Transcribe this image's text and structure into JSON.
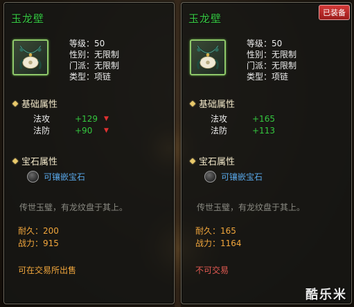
{
  "left_item": {
    "title": "玉龙壁",
    "level": "等级：50",
    "gender": "性别：无限制",
    "sect": "门派：无限制",
    "type": "类型：项链",
    "basic_header": "基础属性",
    "attrs": [
      {
        "label": "法攻",
        "value": "+129",
        "trend": "down"
      },
      {
        "label": "法防",
        "value": "+90",
        "trend": "down"
      }
    ],
    "gem_header": "宝石属性",
    "gem_slot_text": "可镶嵌宝石",
    "description": "传世玉璧，有龙纹盘于其上。",
    "durability": "耐久：200",
    "power": "战力：915",
    "trade": "可在交易所出售"
  },
  "right_item": {
    "badge": "已装备",
    "title": "玉龙壁",
    "level": "等级：50",
    "gender": "性别：无限制",
    "sect": "门派：无限制",
    "type": "类型：项链",
    "basic_header": "基础属性",
    "attrs": [
      {
        "label": "法攻",
        "value": "+165"
      },
      {
        "label": "法防",
        "value": "+113"
      }
    ],
    "gem_header": "宝石属性",
    "gem_slot_text": "可镶嵌宝石",
    "description": "传世玉璧，有龙纹盘于其上。",
    "durability": "耐久：165",
    "power": "战力：1164",
    "trade": "不可交易"
  },
  "colors": {
    "title_green": "#37c443",
    "value_green": "#34c83f",
    "decrease_red": "#e03131",
    "gem_blue": "#58a7e8",
    "stat_orange": "#f1a63c",
    "untradeable_red": "#e35a52"
  },
  "icons": [
    "jade-necklace-icon",
    "down-arrow-icon",
    "diamond-bullet-icon",
    "gem-slot-icon"
  ],
  "watermark": "酷乐米"
}
